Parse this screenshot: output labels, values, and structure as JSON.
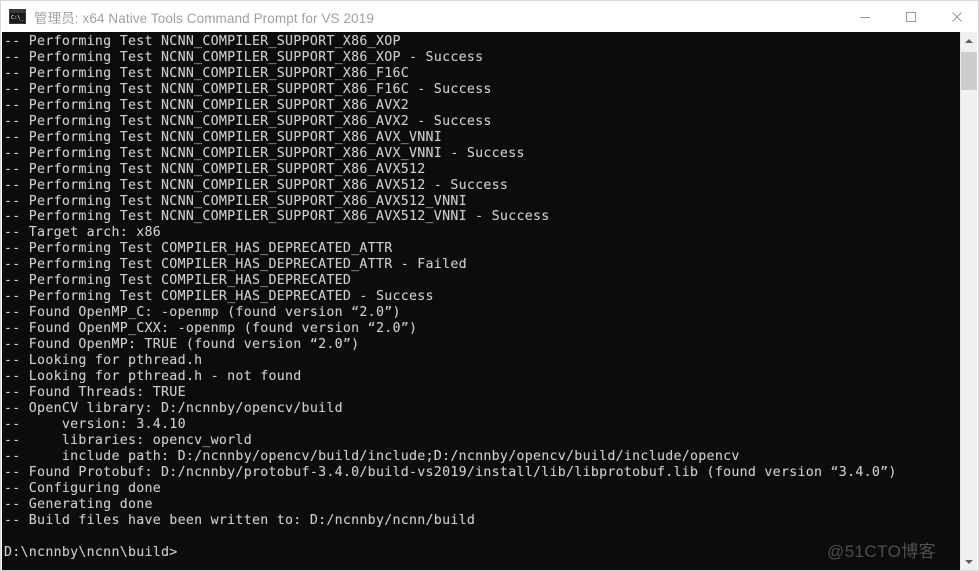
{
  "window": {
    "title": "管理员: x64 Native Tools Command Prompt for VS 2019",
    "icon_name": "console-icon",
    "icon_glyph": "C:\\_",
    "background_color": "#0c0c0c",
    "text_color": "#cccccc",
    "title_color": "#a0a0a0"
  },
  "controls": {
    "minimize_label": "Minimize",
    "maximize_label": "Maximize",
    "close_label": "Close"
  },
  "scrollbar": {
    "up_arrow_label": "Scroll up",
    "down_arrow_label": "Scroll down",
    "thumb_label": "Scroll thumb"
  },
  "watermark": {
    "text": "@51CTO博客"
  },
  "console": {
    "prompt": "D:\\ncnnby\\ncnn\\build>",
    "output": "-- Performing Test NCNN_COMPILER_SUPPORT_X86_XOP\n-- Performing Test NCNN_COMPILER_SUPPORT_X86_XOP - Success\n-- Performing Test NCNN_COMPILER_SUPPORT_X86_F16C\n-- Performing Test NCNN_COMPILER_SUPPORT_X86_F16C - Success\n-- Performing Test NCNN_COMPILER_SUPPORT_X86_AVX2\n-- Performing Test NCNN_COMPILER_SUPPORT_X86_AVX2 - Success\n-- Performing Test NCNN_COMPILER_SUPPORT_X86_AVX_VNNI\n-- Performing Test NCNN_COMPILER_SUPPORT_X86_AVX_VNNI - Success\n-- Performing Test NCNN_COMPILER_SUPPORT_X86_AVX512\n-- Performing Test NCNN_COMPILER_SUPPORT_X86_AVX512 - Success\n-- Performing Test NCNN_COMPILER_SUPPORT_X86_AVX512_VNNI\n-- Performing Test NCNN_COMPILER_SUPPORT_X86_AVX512_VNNI - Success\n-- Target arch: x86\n-- Performing Test COMPILER_HAS_DEPRECATED_ATTR\n-- Performing Test COMPILER_HAS_DEPRECATED_ATTR - Failed\n-- Performing Test COMPILER_HAS_DEPRECATED\n-- Performing Test COMPILER_HAS_DEPRECATED - Success\n-- Found OpenMP_C: -openmp (found version “2.0”)\n-- Found OpenMP_CXX: -openmp (found version “2.0”)\n-- Found OpenMP: TRUE (found version “2.0”)\n-- Looking for pthread.h\n-- Looking for pthread.h - not found\n-- Found Threads: TRUE\n-- OpenCV library: D:/ncnnby/opencv/build\n--     version: 3.4.10\n--     libraries: opencv_world\n--     include path: D:/ncnnby/opencv/build/include;D:/ncnnby/opencv/build/include/opencv\n-- Found Protobuf: D:/ncnnby/protobuf-3.4.0/build-vs2019/install/lib/libprotobuf.lib (found version “3.4.0”)\n-- Configuring done\n-- Generating done\n-- Build files have been written to: D:/ncnnby/ncnn/build\n\nD:\\ncnnby\\ncnn\\build>"
  }
}
